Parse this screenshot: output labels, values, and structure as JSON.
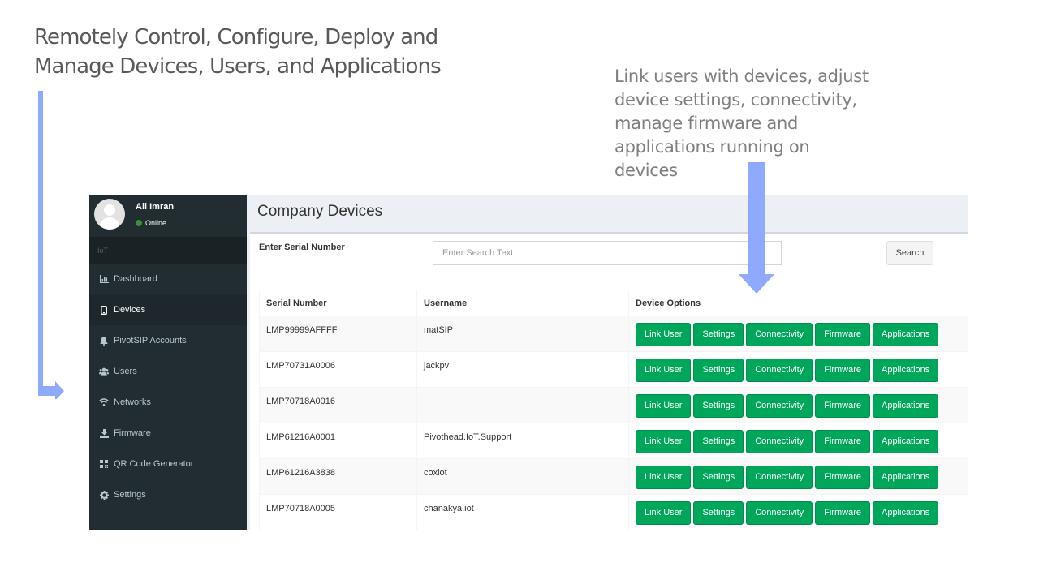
{
  "slide": {
    "headline_lines": [
      "Remotely Control, Configure, Deploy and",
      "Manage Devices, Users, and Applications"
    ],
    "callout_lines": [
      "Link users with devices, adjust",
      "device settings,  connectivity,",
      "manage firmware and",
      "applications running on",
      "devices"
    ],
    "arrow_color": "#8fa9ff"
  },
  "sidebar": {
    "user": {
      "name": "Ali Imran",
      "status": "Online"
    },
    "section_header": "IoT",
    "items": [
      {
        "label": "Dashboard",
        "icon": "bar-chart-icon"
      },
      {
        "label": "Devices",
        "icon": "mobile-icon",
        "active": true
      },
      {
        "label": "PivotSIP Accounts",
        "icon": "bell-icon"
      },
      {
        "label": "Users",
        "icon": "users-icon"
      },
      {
        "label": "Networks",
        "icon": "wifi-icon"
      },
      {
        "label": "Firmware",
        "icon": "download-icon"
      },
      {
        "label": "QR Code Generator",
        "icon": "qrcode-icon"
      },
      {
        "label": "Settings",
        "icon": "gear-icon"
      }
    ]
  },
  "main": {
    "title": "Company Devices",
    "search": {
      "label": "Enter Serial Number",
      "placeholder": "Enter Search Text",
      "button": "Search"
    },
    "table": {
      "columns": [
        "Serial Number",
        "Username",
        "Device Options"
      ],
      "option_buttons": [
        "Link User",
        "Settings",
        "Connectivity",
        "Firmware",
        "Applications"
      ],
      "rows": [
        {
          "serial": "LMP99999AFFFF",
          "username": "matSIP"
        },
        {
          "serial": "LMP70731A0006",
          "username": "jackpv"
        },
        {
          "serial": "LMP70718A0016",
          "username": ""
        },
        {
          "serial": "LMP61216A0001",
          "username": "Pivothead.IoT.Support"
        },
        {
          "serial": "LMP61216A3838",
          "username": "coxiot"
        },
        {
          "serial": "LMP70718A0005",
          "username": "chanakya.iot"
        }
      ]
    }
  },
  "colors": {
    "sidebar_bg": "#222d32",
    "sidebar_active_bg": "#1e282c",
    "button_green": "#00a65a",
    "online_green": "#3c8d3c"
  }
}
